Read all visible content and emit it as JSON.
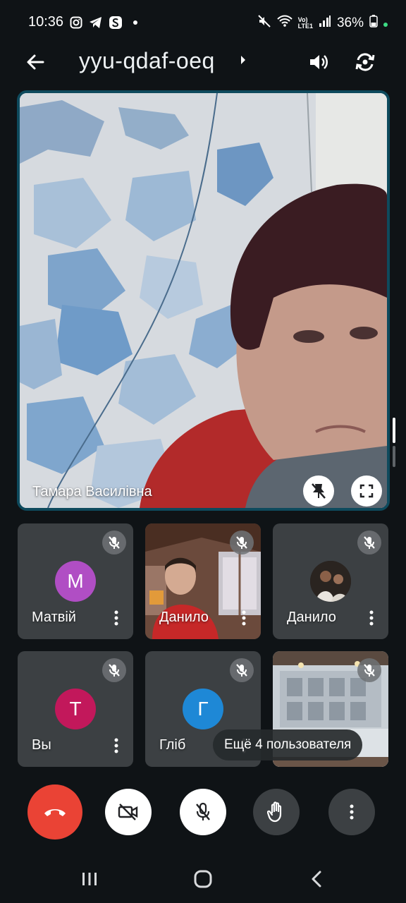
{
  "status_bar": {
    "time": "10:36",
    "left_icons": [
      "instagram-icon",
      "telegram-icon",
      "skype-icon",
      "dot-icon"
    ],
    "right_icons": [
      "mute-icon",
      "wifi-icon",
      "volte-icon",
      "signal-icon"
    ],
    "battery": "36%"
  },
  "top_bar": {
    "title": "yyu-qdaf-oeq"
  },
  "main_tile": {
    "name": "Тамара Василівна"
  },
  "participants": [
    {
      "name": "Матвій",
      "avatar_letter": "M",
      "avatar_color": "#b04ec4",
      "type": "avatar"
    },
    {
      "name": "Данило",
      "type": "video"
    },
    {
      "name": "Данило",
      "type": "photo"
    },
    {
      "name": "Вы",
      "avatar_letter": "Т",
      "avatar_color": "#c2185b",
      "type": "avatar"
    },
    {
      "name": "Гліб",
      "avatar_letter": "Г",
      "avatar_color": "#1e88d6",
      "type": "avatar"
    },
    {
      "type": "video"
    }
  ],
  "more_users": "Ещё 4 пользователя",
  "colors": {
    "background": "#0f1316",
    "tile": "#3c4043",
    "end_call": "#ea4335",
    "active_border": "#0e4a5d"
  }
}
